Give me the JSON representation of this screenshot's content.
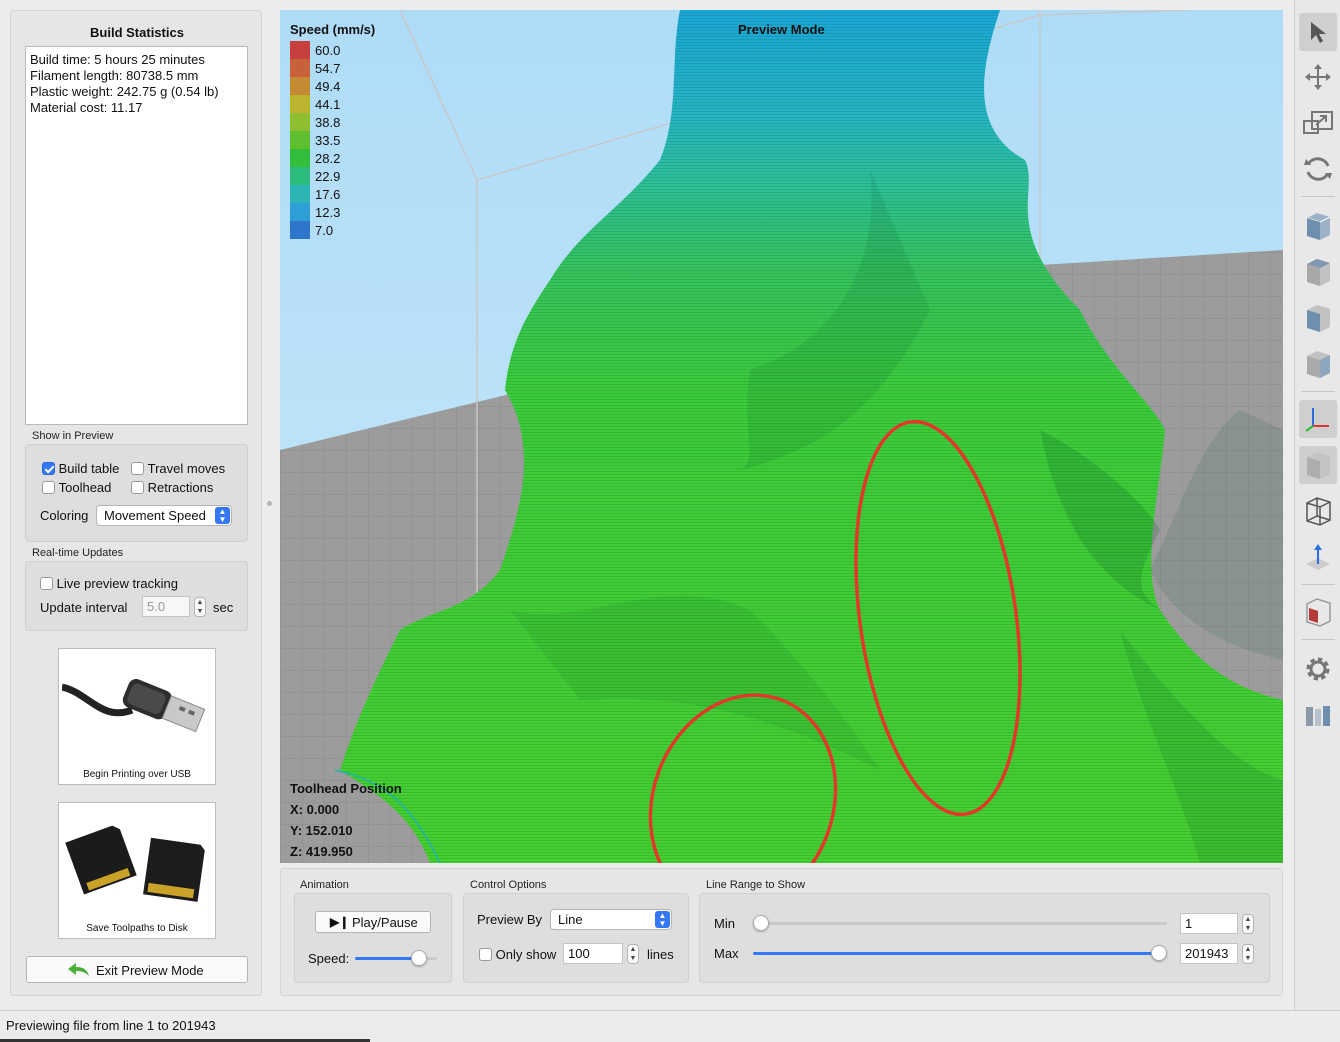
{
  "build_statistics": {
    "title": "Build Statistics",
    "lines": [
      "Build time: 5 hours 25 minutes",
      "Filament length: 80738.5 mm",
      "Plastic weight: 242.75 g (0.54 lb)",
      "Material cost: 11.17"
    ]
  },
  "show_in_preview": {
    "label": "Show in Preview",
    "build_table": {
      "label": "Build table",
      "checked": true
    },
    "travel_moves": {
      "label": "Travel moves",
      "checked": false
    },
    "toolhead": {
      "label": "Toolhead",
      "checked": false
    },
    "retractions": {
      "label": "Retractions",
      "checked": false
    },
    "coloring_label": "Coloring",
    "coloring_value": "Movement Speed"
  },
  "realtime_updates": {
    "label": "Real-time Updates",
    "live_preview": {
      "label": "Live preview tracking",
      "checked": false
    },
    "update_interval_label": "Update interval",
    "update_interval_value": "5.0",
    "update_interval_unit": "sec"
  },
  "cards": {
    "usb": {
      "label": "Begin Printing over USB"
    },
    "sd": {
      "label": "Save Toolpaths to Disk"
    }
  },
  "exit_button": {
    "label": "Exit Preview Mode"
  },
  "viewport": {
    "mode_label": "Preview Mode",
    "legend_title": "Speed (mm/s)",
    "legend": [
      {
        "value": "60.0",
        "color": "#c8403e"
      },
      {
        "value": "54.7",
        "color": "#c8603a"
      },
      {
        "value": "49.4",
        "color": "#c68a33"
      },
      {
        "value": "44.1",
        "color": "#bcb42e"
      },
      {
        "value": "38.8",
        "color": "#8ebf2e"
      },
      {
        "value": "33.5",
        "color": "#5fbf2f"
      },
      {
        "value": "28.2",
        "color": "#32bd3a"
      },
      {
        "value": "22.9",
        "color": "#2cbc7c"
      },
      {
        "value": "17.6",
        "color": "#2cb5b5"
      },
      {
        "value": "12.3",
        "color": "#2ea0d6"
      },
      {
        "value": "7.0",
        "color": "#2f75cc"
      }
    ],
    "toolhead_position": {
      "title": "Toolhead Position",
      "x": "X: 0.000",
      "y": "Y: 152.010",
      "z": "Z: 419.950"
    }
  },
  "animation": {
    "label": "Animation",
    "play_pause_label": "Play/Pause",
    "speed_label": "Speed:",
    "speed_fraction": 0.85
  },
  "control_options": {
    "label": "Control Options",
    "preview_by_label": "Preview By",
    "preview_by_value": "Line",
    "only_show": {
      "label": "Only show",
      "checked": false
    },
    "only_show_value": "100",
    "lines_unit": "lines"
  },
  "line_range": {
    "label": "Line Range to Show",
    "min_label": "Min",
    "min_value": "1",
    "max_label": "Max",
    "max_value": "201943",
    "min_fraction": 0.0,
    "max_fraction": 1.0
  },
  "status": {
    "text": "Previewing file from line 1 to 201943"
  },
  "toolbar": {
    "tools": [
      "select-tool",
      "move-tool",
      "scale-tool",
      "rotate-tool",
      "view-front",
      "view-top",
      "view-left",
      "view-right",
      "axes-toggle",
      "view-iso",
      "wireframe-view",
      "normal-view",
      "bed-view",
      "settings",
      "library"
    ]
  }
}
